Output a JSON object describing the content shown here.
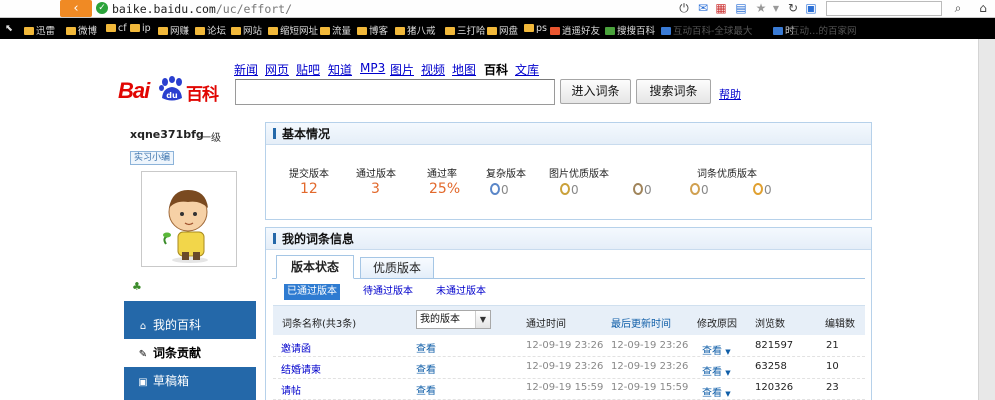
{
  "browser": {
    "url_host": "baike.baidu.com",
    "url_path": "/uc/effort/",
    "bookmarks": [
      "迅雷",
      "微博",
      "cf",
      "ip",
      "网赚",
      "论坛",
      "网站",
      "缩短网址",
      "流量",
      "博客",
      "猪八戒",
      "三打哈",
      "网盘",
      "ps",
      "逍遥好友",
      "搜搜百科",
      "互动百科-全球最大",
      "时",
      "互动…的百家网"
    ]
  },
  "site": {
    "logo_text_bai": "Bai",
    "logo_text_du": "du",
    "logo_text_baike": "百科",
    "nav": [
      "新闻",
      "网页",
      "贴吧",
      "知道",
      "MP3",
      "图片",
      "视频",
      "地图",
      "百科",
      "文库"
    ],
    "nav_current": "百科",
    "search_value": "",
    "enter_button": "进入词条",
    "search_button": "搜索词条",
    "help_link": "帮助"
  },
  "user": {
    "name": "xqne371bfg",
    "level": "一级",
    "badge": "实习小编"
  },
  "left_nav": [
    {
      "label": "我的百科",
      "icon": "home-icon",
      "glyph": "⌂"
    },
    {
      "label": "词条贡献",
      "icon": "bulb-icon",
      "glyph": "✎"
    },
    {
      "label": "草稿箱",
      "icon": "draft-icon",
      "glyph": "▣"
    }
  ],
  "basic_info": {
    "title": "基本情况",
    "stats": [
      {
        "label": "提交版本",
        "value": "12"
      },
      {
        "label": "通过版本",
        "value": "3"
      },
      {
        "label": "通过率",
        "value": "25%"
      }
    ],
    "medals_label_left": "复杂版本",
    "medals_label_mid": "图片优质版本",
    "medals_label_right": "词条优质版本",
    "medals": [
      "0",
      "0",
      "0",
      "0",
      "0"
    ]
  },
  "entries": {
    "title": "我的词条信息",
    "tabs": [
      "版本状态",
      "优质版本"
    ],
    "subtabs": [
      "已通过版本",
      "待通过版本",
      "未通过版本"
    ],
    "columns": {
      "name": "词条名称(共3条)",
      "version_select": "我的版本",
      "pass_time": "通过时间",
      "last_update": "最后更新时间",
      "reason": "修改原因",
      "views": "浏览数",
      "edits": "编辑数"
    },
    "rows": [
      {
        "name": "邀请函",
        "view": "查看",
        "pass_time": "12-09-19 23:26",
        "last_update": "12-09-19 23:26",
        "reason": "查看",
        "views": "821597",
        "edits": "21"
      },
      {
        "name": "结婚请柬",
        "view": "查看",
        "pass_time": "12-09-19 23:26",
        "last_update": "12-09-19 23:26",
        "reason": "查看",
        "views": "63258",
        "edits": "10"
      },
      {
        "name": "请帖",
        "view": "查看",
        "pass_time": "12-09-19 15:59",
        "last_update": "12-09-19 15:59",
        "reason": "查看",
        "views": "120326",
        "edits": "23"
      }
    ]
  }
}
